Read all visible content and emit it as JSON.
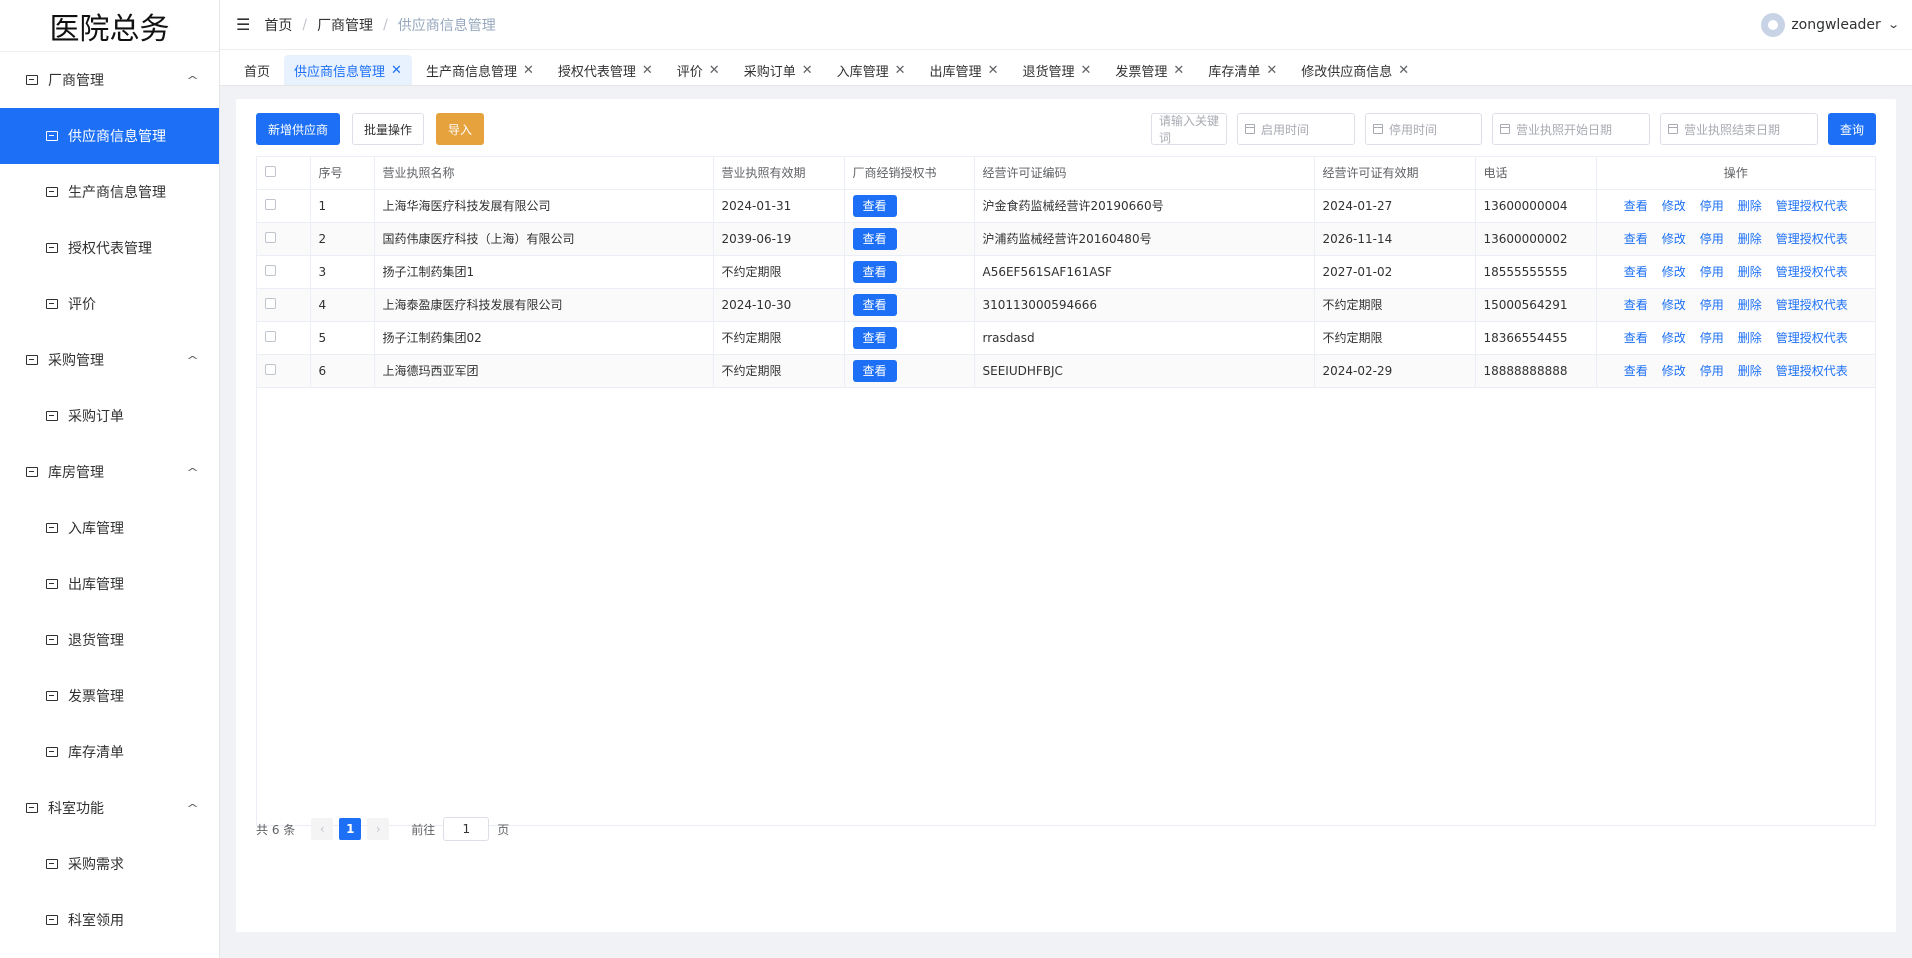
{
  "app": {
    "title": "医院总务"
  },
  "sidebar": {
    "groups": [
      {
        "label": "厂商管理",
        "items": [
          {
            "label": "供应商信息管理",
            "active": true
          },
          {
            "label": "生产商信息管理"
          },
          {
            "label": "授权代表管理"
          },
          {
            "label": "评价"
          }
        ]
      },
      {
        "label": "采购管理",
        "items": [
          {
            "label": "采购订单"
          }
        ]
      },
      {
        "label": "库房管理",
        "items": [
          {
            "label": "入库管理"
          },
          {
            "label": "出库管理"
          },
          {
            "label": "退货管理"
          },
          {
            "label": "发票管理"
          },
          {
            "label": "库存清单"
          }
        ]
      },
      {
        "label": "科室功能",
        "items": [
          {
            "label": "采购需求"
          },
          {
            "label": "科室领用"
          }
        ]
      }
    ]
  },
  "header": {
    "breadcrumb": [
      "首页",
      "厂商管理",
      "供应商信息管理"
    ],
    "separator": "/",
    "username": "zongwleader"
  },
  "tabs": [
    {
      "label": "首页",
      "closable": false
    },
    {
      "label": "供应商信息管理",
      "closable": true,
      "active": true
    },
    {
      "label": "生产商信息管理",
      "closable": true
    },
    {
      "label": "授权代表管理",
      "closable": true
    },
    {
      "label": "评价",
      "closable": true
    },
    {
      "label": "采购订单",
      "closable": true
    },
    {
      "label": "入库管理",
      "closable": true
    },
    {
      "label": "出库管理",
      "closable": true
    },
    {
      "label": "退货管理",
      "closable": true
    },
    {
      "label": "发票管理",
      "closable": true
    },
    {
      "label": "库存清单",
      "closable": true
    },
    {
      "label": "修改供应商信息",
      "closable": true
    }
  ],
  "toolbar": {
    "add_label": "新增供应商",
    "batch_label": "批量操作",
    "import_label": "导入",
    "keyword_placeholder": "请输入关键词",
    "start_time_placeholder": "启用时间",
    "stop_time_placeholder": "停用时间",
    "license_start_placeholder": "营业执照开始日期",
    "license_end_placeholder": "营业执照结束日期",
    "search_label": "查询"
  },
  "table": {
    "columns": [
      "序号",
      "营业执照名称",
      "营业执照有效期",
      "厂商经销授权书",
      "经营许可证编码",
      "经营许可证有效期",
      "电话",
      "操作"
    ],
    "view_label": "查看",
    "actions": [
      "查看",
      "修改",
      "停用",
      "删除",
      "管理授权代表"
    ],
    "rows": [
      {
        "no": "1",
        "name": "上海华海医疗科技发展有限公司",
        "license_valid": "2024-01-31",
        "permit_code": "沪金食药监械经营许20190660号",
        "permit_valid": "2024-01-27",
        "phone": "13600000004"
      },
      {
        "no": "2",
        "name": "国药伟康医疗科技（上海）有限公司",
        "license_valid": "2039-06-19",
        "permit_code": "沪浦药监械经营许20160480号",
        "permit_valid": "2026-11-14",
        "phone": "13600000002"
      },
      {
        "no": "3",
        "name": "扬子江制药集团1",
        "license_valid": "不约定期限",
        "permit_code": "A56EF561SAF161ASF",
        "permit_valid": "2027-01-02",
        "phone": "18555555555"
      },
      {
        "no": "4",
        "name": "上海泰盈康医疗科技发展有限公司",
        "license_valid": "2024-10-30",
        "permit_code": "310113000594666",
        "permit_valid": "不约定期限",
        "phone": "15000564291"
      },
      {
        "no": "5",
        "name": "扬子江制药集团02",
        "license_valid": "不约定期限",
        "permit_code": "rrasdasd",
        "permit_valid": "不约定期限",
        "phone": "18366554455"
      },
      {
        "no": "6",
        "name": "上海德玛西亚军团",
        "license_valid": "不约定期限",
        "permit_code": "SEEIUDHFBJC",
        "permit_valid": "2024-02-29",
        "phone": "18888888888"
      }
    ]
  },
  "pagination": {
    "total_label": "共 6 条",
    "current_page": "1",
    "goto_label": "前往",
    "goto_value": "1",
    "page_suffix": "页",
    "prev_icon": "‹",
    "next_icon": "›"
  },
  "colors": {
    "primary": "#1d70f5",
    "warning": "#e6a23c"
  }
}
